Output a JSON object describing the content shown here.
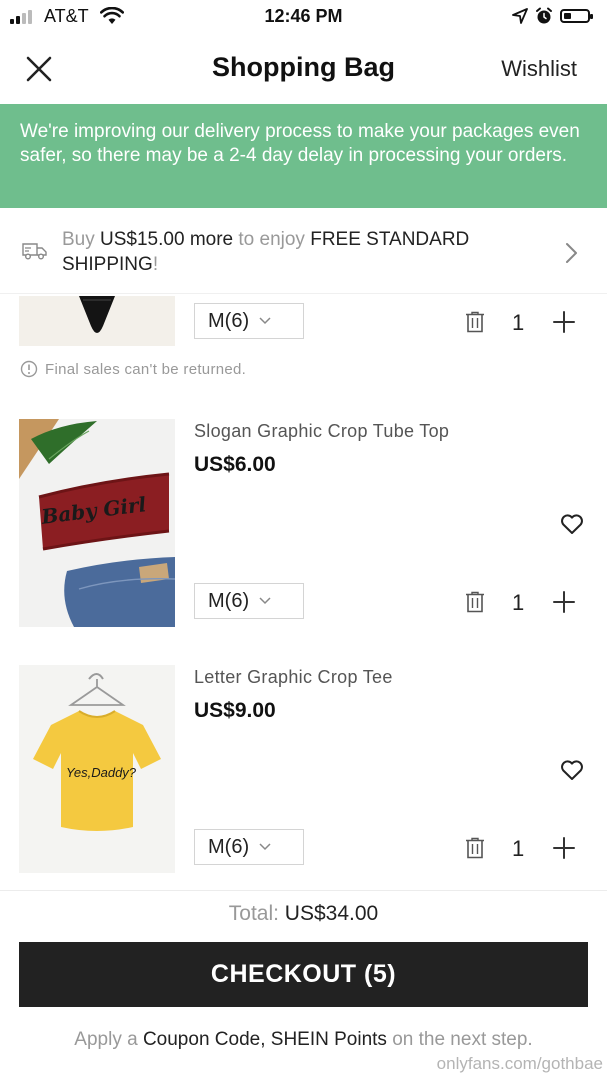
{
  "status_bar": {
    "carrier": "AT&T",
    "time": "12:46 PM"
  },
  "header": {
    "title": "Shopping Bag",
    "wishlist_label": "Wishlist"
  },
  "banner": {
    "text": "We're improving our delivery process to make your packages even safer, so there may be a 2-4 day delay in processing your orders."
  },
  "shipping": {
    "part1": "Buy ",
    "amount": "US$15.00 more",
    "part2": " to enjoy ",
    "highlight": "FREE STANDARD SHIPPING",
    "part3": "!"
  },
  "items": [
    {
      "size": "M(6)",
      "quantity": "1",
      "note": "Final sales can't be returned."
    },
    {
      "title": "Slogan Graphic Crop Tube Top",
      "price": "US$6.00",
      "size": "M(6)",
      "quantity": "1",
      "print": "Baby Girl"
    },
    {
      "title": "Letter Graphic Crop Tee",
      "price": "US$9.00",
      "size": "M(6)",
      "quantity": "1",
      "print": "Yes,Daddy?"
    }
  ],
  "footer": {
    "total_label": "Total:",
    "total_value": " US$34.00",
    "checkout_label": "CHECKOUT (5)",
    "coupon_part1": "Apply a ",
    "coupon_highlight": "Coupon Code, SHEIN Points",
    "coupon_part2": " on the next step."
  },
  "watermark": "onlyfans.com/gothbae",
  "colors": {
    "banner": "#6fbe8d",
    "checkout": "#222222",
    "muted": "#999999"
  }
}
